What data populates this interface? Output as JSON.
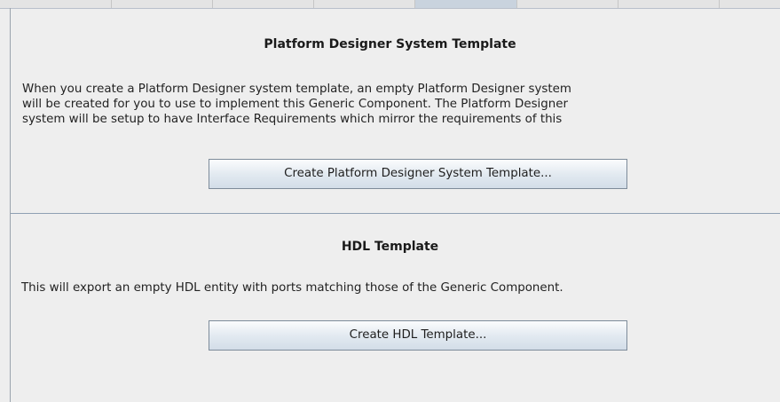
{
  "platform_section": {
    "title": "Platform Designer System Template",
    "description_lines": [
      "When you create a Platform Designer system template, an empty Platform Designer system",
      "will be created for you to use to implement this Generic Component. The Platform Designer",
      "system will be setup to have Interface Requirements which mirror the requirements of this"
    ],
    "button_label": "Create Platform Designer System Template..."
  },
  "hdl_section": {
    "title": "HDL Template",
    "description": "This will export an empty HDL entity with ports matching those of the Generic Component.",
    "button_label": "Create HDL Template..."
  }
}
